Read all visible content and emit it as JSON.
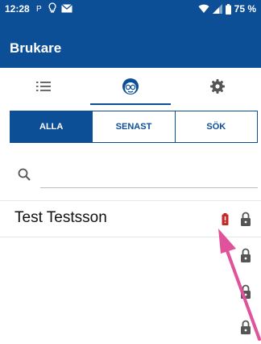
{
  "status_bar": {
    "time": "12:28",
    "battery_text": "75 %",
    "icons": [
      "p-icon",
      "bulb-icon",
      "mail-icon",
      "wifi-icon",
      "signal-icon",
      "battery-icon"
    ]
  },
  "app_bar": {
    "title": "Brukare"
  },
  "tabs": [
    {
      "icon": "list-icon"
    },
    {
      "icon": "client-face-icon",
      "active": true
    },
    {
      "icon": "gear-icon"
    }
  ],
  "segment": {
    "items": [
      {
        "label": "ALLA",
        "active": true
      },
      {
        "label": "SENAST"
      },
      {
        "label": "SÖK"
      }
    ]
  },
  "search": {
    "placeholder": "",
    "value": ""
  },
  "rows": [
    {
      "name": "Test Testsson",
      "has_alert": true,
      "locked": true
    },
    {
      "name": "",
      "has_alert": false,
      "locked": true
    },
    {
      "name": "",
      "has_alert": false,
      "locked": true
    },
    {
      "name": "",
      "has_alert": false,
      "locked": true
    }
  ],
  "colors": {
    "primary": "#0d4f96",
    "alert": "#c62828",
    "lock": "#555555",
    "arrow": "#e0529a"
  }
}
